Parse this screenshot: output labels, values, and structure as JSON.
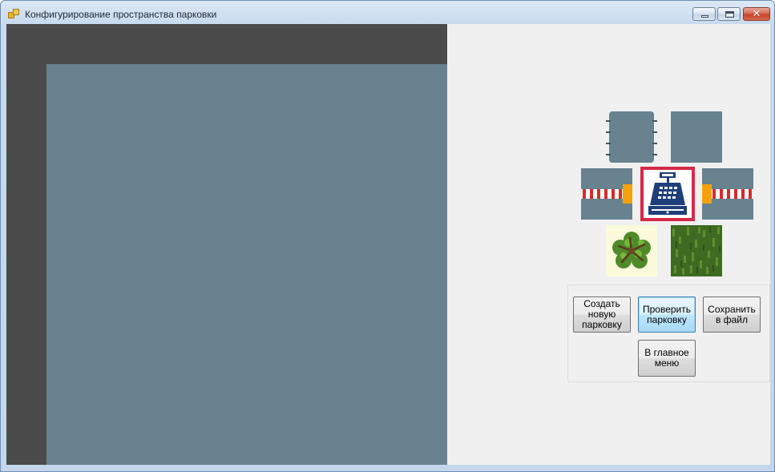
{
  "window": {
    "title": "Конфигурирование пространства парковки",
    "caption_buttons": [
      "minimize-icon",
      "maximize-icon",
      "close-icon"
    ]
  },
  "canvas": {
    "border_color": "#4b4b4b",
    "field_color": "#68828f"
  },
  "palette": {
    "tiles": [
      {
        "name": "parking-spot-icon"
      },
      {
        "name": "road-tile-icon"
      },
      {
        "name": "entry-barrier-icon"
      },
      {
        "name": "cash-register-icon"
      },
      {
        "name": "exit-barrier-icon"
      },
      {
        "name": "tree-icon"
      },
      {
        "name": "grass-icon"
      }
    ],
    "selected_tile": "cash-register-icon",
    "selection_color": "#d52a48"
  },
  "actions": {
    "create_label": "Создать новую парковку",
    "check_label": "Проверить парковку",
    "save_label": "Сохранить в файл",
    "menu_label": "В главное меню"
  }
}
